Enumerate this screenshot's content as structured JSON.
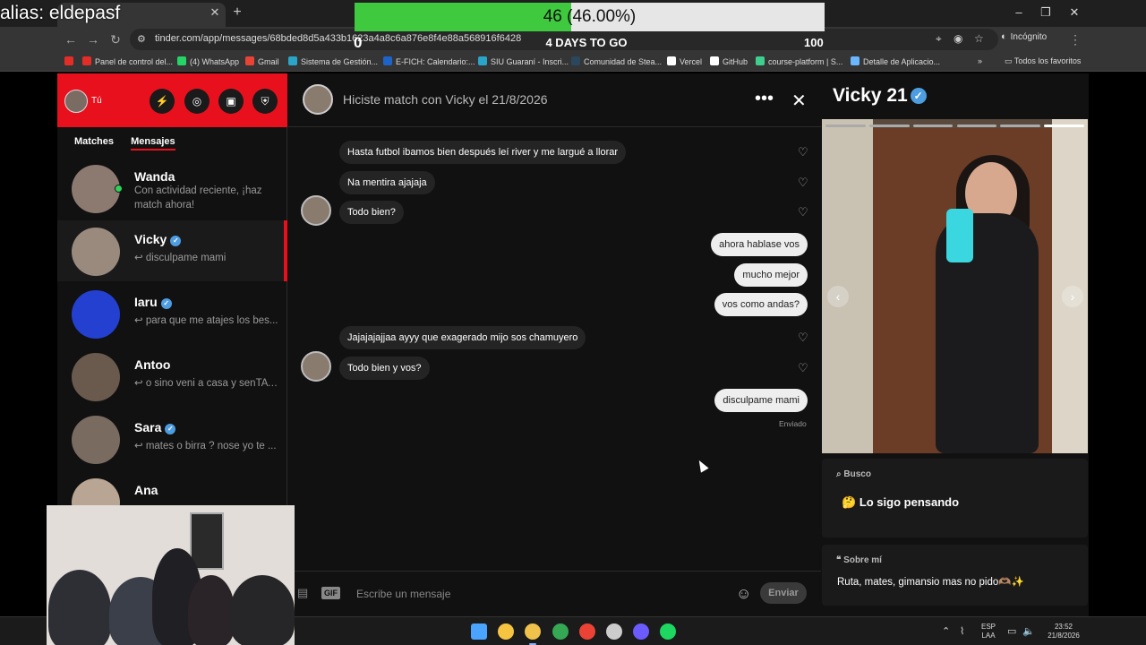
{
  "overlay": {
    "alias": "alias: eldepasf",
    "progress_text": "46 (46.00%)",
    "progress_fraction": 0.46,
    "progress_min": "0",
    "progress_max": "100",
    "days_to_go": "4 DAYS TO GO"
  },
  "browser": {
    "url": "tinder.com/app/messages/68bded8d5a433b1623a4a8c6a876e8f4e88a568916f6428",
    "incognito_label": "Incógnito",
    "bookmarks": [
      {
        "label": "Panel de control del...",
        "color": "#e52d27"
      },
      {
        "label": "(4) WhatsApp",
        "color": "#25d366"
      },
      {
        "label": "Gmail",
        "color": "#ea4335"
      },
      {
        "label": "Sistema de Gestión...",
        "color": "#2aa5c9"
      },
      {
        "label": "E-FICH: Calendario:...",
        "color": "#1e64c8"
      },
      {
        "label": "SIU Guaraní - Inscri...",
        "color": "#2aa5c9"
      },
      {
        "label": "Comunidad de Stea...",
        "color": "#2a475e"
      },
      {
        "label": "Vercel",
        "color": "#ffffff"
      },
      {
        "label": "GitHub",
        "color": "#ffffff"
      },
      {
        "label": "course-platform | S...",
        "color": "#3ecf8e"
      },
      {
        "label": "Detalle de Aplicacio...",
        "color": "#6ab7ff"
      }
    ],
    "all_bookmarks": "Todos los favoritos"
  },
  "sidebar": {
    "me_label": "Tú",
    "tabs": [
      "Matches",
      "Mensajes"
    ],
    "items": [
      {
        "name": "Wanda",
        "message": "Con actividad reciente, ¡haz match ahora!",
        "verified": false,
        "online": true,
        "color": "#8c7a70"
      },
      {
        "name": "Vicky",
        "message": "↩ disculpame mami",
        "verified": true,
        "online": false,
        "color": "#9a8a7e"
      },
      {
        "name": "Iaru",
        "message": "↩ para que me atajes los bes...",
        "verified": true,
        "online": false,
        "color": "#2440d0"
      },
      {
        "name": "Antoo",
        "message": "↩ o sino veni a casa y senTATE",
        "verified": false,
        "online": false,
        "color": "#6a5a4d"
      },
      {
        "name": "Sara",
        "message": "↩ mates o birra ? nose yo te ...",
        "verified": true,
        "online": false,
        "color": "#7a6b60"
      },
      {
        "name": "Ana",
        "message": "",
        "verified": false,
        "online": false,
        "color": "#b8a594"
      }
    ]
  },
  "chat": {
    "title": "Hiciste match con Vicky el 21/8/2026",
    "messages": [
      {
        "dir": "in",
        "text": "Hasta futbol ibamos bien después leí river y me largué a llorar"
      },
      {
        "dir": "in",
        "text": "Na mentira ajajaja"
      },
      {
        "dir": "in",
        "text": "Todo bien?"
      },
      {
        "dir": "out",
        "text": "ahora hablase vos"
      },
      {
        "dir": "out",
        "text": "mucho mejor"
      },
      {
        "dir": "out",
        "text": "vos como andas?"
      },
      {
        "dir": "in",
        "text": "Jajajajajjaa ayyy que exagerado mijo sos chamuyero"
      },
      {
        "dir": "in",
        "text": "Todo bien y vos?"
      },
      {
        "dir": "out",
        "text": "disculpame mami"
      }
    ],
    "sent_label": "Enviado",
    "composer_placeholder": "Escribe un mensaje",
    "gif_label": "GIF",
    "send_label": "Enviar"
  },
  "profile": {
    "name_age": "Vicky 21",
    "photo_count": 6,
    "current_photo": 6,
    "looking_section": "Busco",
    "looking_value": "Lo sigo pensando",
    "about_section": "Sobre mí",
    "about_text": "Ruta, mates, gimansio mas no pido🫶🏽✨"
  },
  "taskbar": {
    "lang": "ESP",
    "layout": "LAA",
    "time": "23:52",
    "date": "21/8/2026"
  }
}
